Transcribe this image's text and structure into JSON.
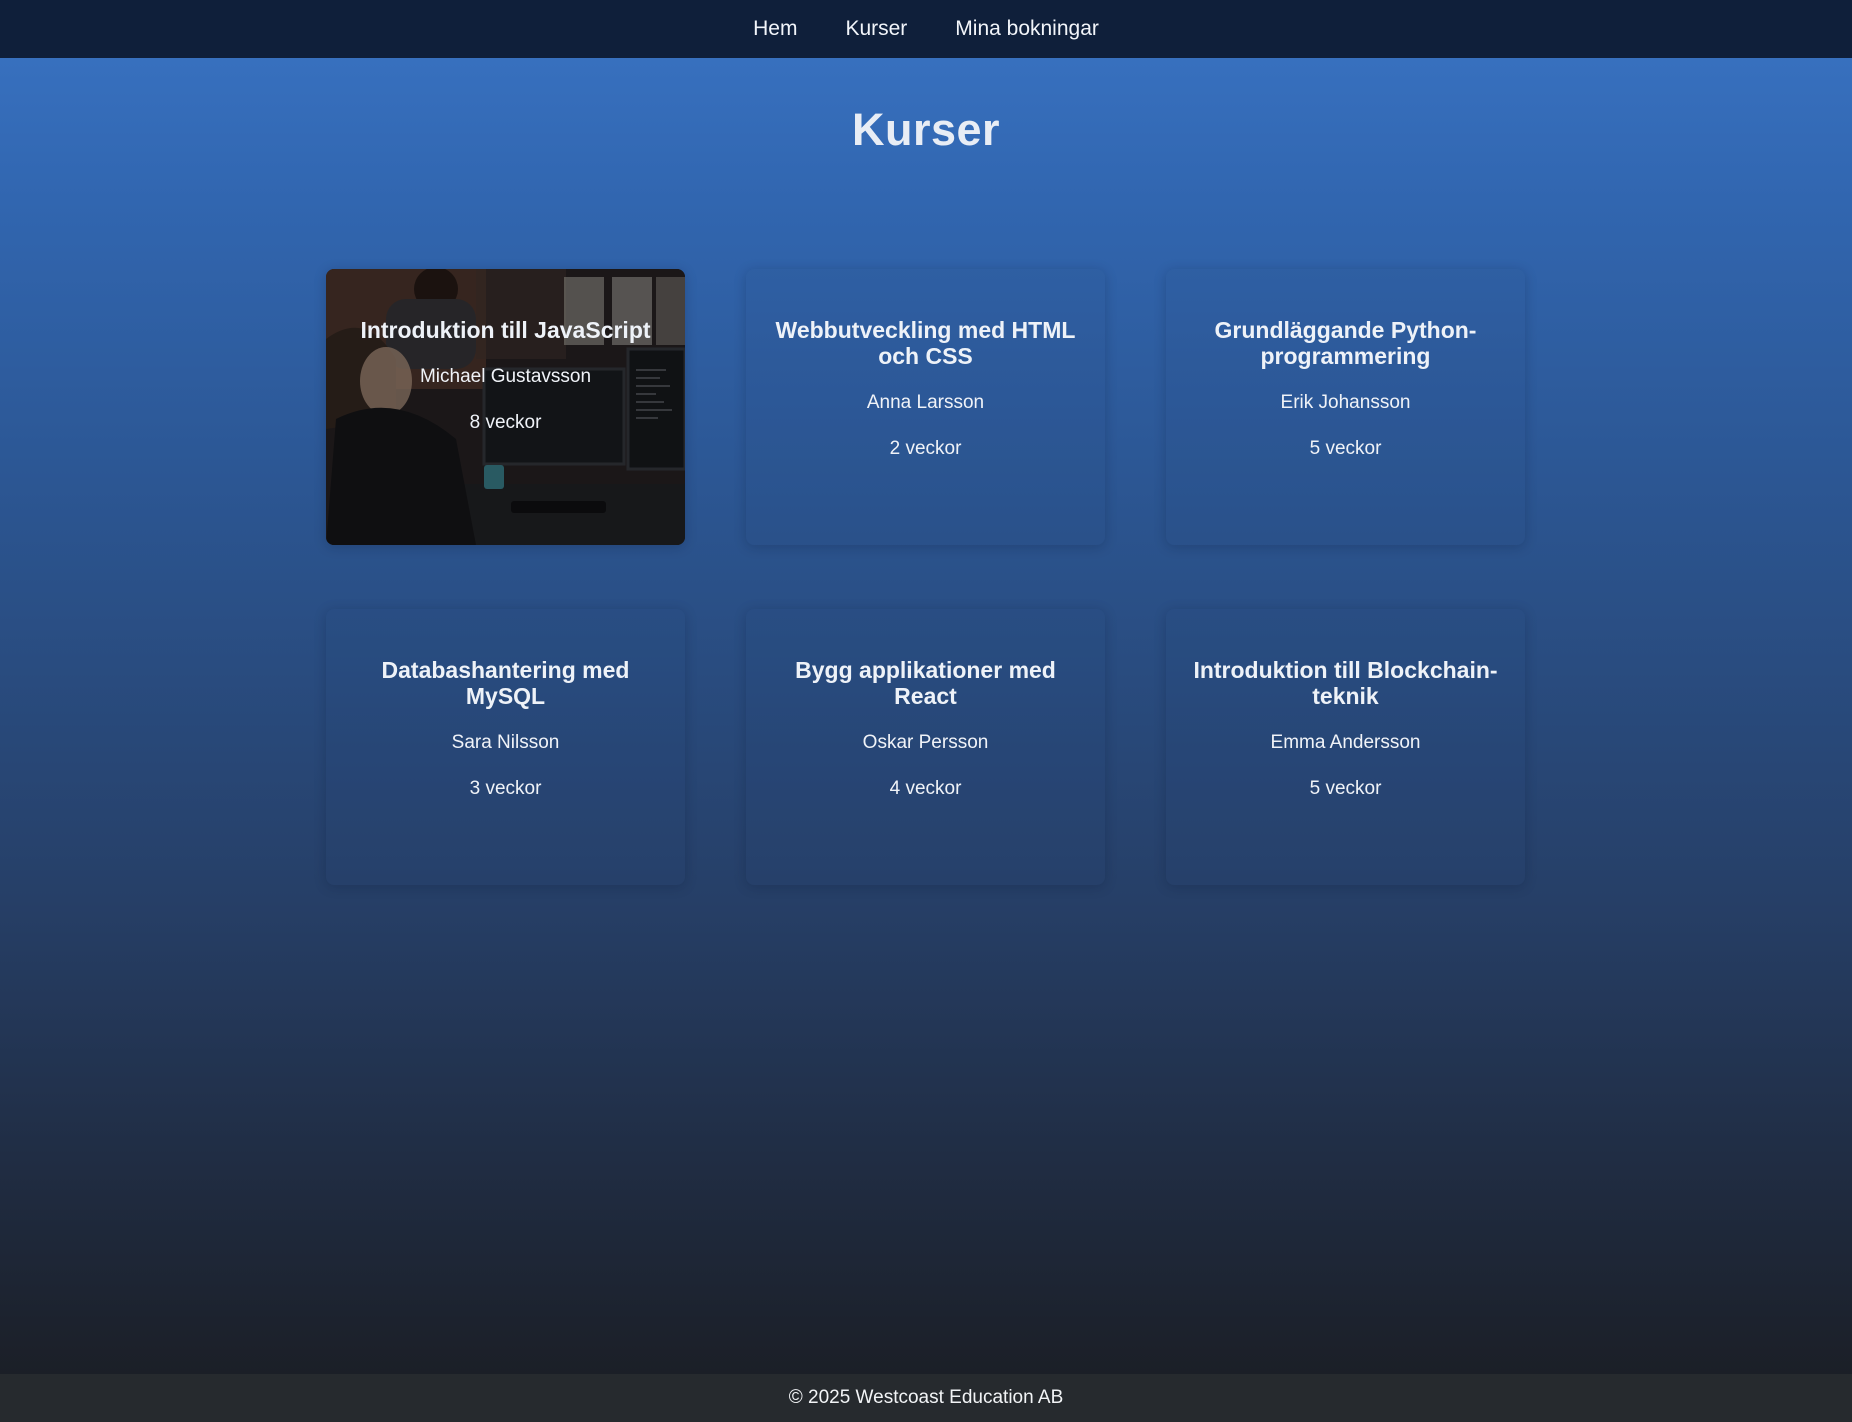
{
  "nav": {
    "items": [
      {
        "label": "Hem"
      },
      {
        "label": "Kurser"
      },
      {
        "label": "Mina bokningar"
      }
    ]
  },
  "page": {
    "title": "Kurser"
  },
  "courses": [
    {
      "title": "Introduktion till JavaScript",
      "teacher": "Michael Gustavsson",
      "duration": "8 veckor",
      "featured": true
    },
    {
      "title": "Webbutveckling med HTML och CSS",
      "teacher": "Anna Larsson",
      "duration": "2 veckor"
    },
    {
      "title": "Grundläggande Python-programmering",
      "teacher": "Erik Johansson",
      "duration": "5 veckor"
    },
    {
      "title": "Databashantering med MySQL",
      "teacher": "Sara Nilsson",
      "duration": "3 veckor"
    },
    {
      "title": "Bygg applikationer med React",
      "teacher": "Oskar Persson",
      "duration": "4 veckor"
    },
    {
      "title": "Introduktion till Blockchain-teknik",
      "teacher": "Emma Andersson",
      "duration": "5 veckor"
    }
  ],
  "footer": {
    "text": "© 2025 Westcoast Education AB"
  },
  "colors": {
    "navbar": "#0f1f3a",
    "footer": "#262a2e",
    "gradient_top": "#3a74c4",
    "gradient_bottom": "#1b1f27"
  }
}
